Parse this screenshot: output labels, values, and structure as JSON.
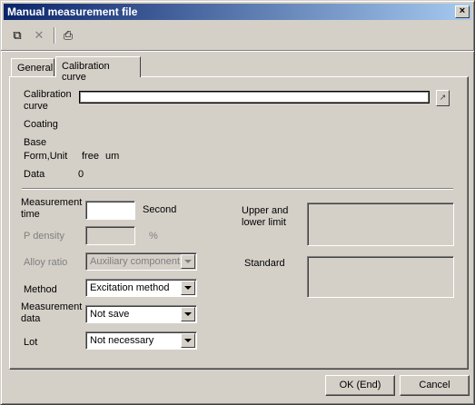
{
  "window": {
    "title": "Manual measurement file",
    "close_glyph": "×"
  },
  "toolbar": {
    "copy_icon": "copy-icon",
    "delete_icon": "delete-x-icon",
    "print_icon": "printer-icon",
    "copy_glyph": "⧉",
    "delete_glyph": "✕",
    "print_glyph": "⎙"
  },
  "tabs": [
    {
      "label": "General"
    },
    {
      "label": "Calibration curve"
    }
  ],
  "calibration": {
    "curve_label_line1": "Calibration",
    "curve_label_line2": "curve",
    "curve_value": "",
    "browse_glyph": "↗",
    "coating_label": "Coating",
    "base_label": "Base",
    "form_unit_label": "Form,Unit",
    "form_value": "free",
    "unit_value": "um",
    "data_label": "Data",
    "data_value": "0"
  },
  "measurement": {
    "time_label_line1": "Measurement",
    "time_label_line2": "time",
    "time_value": "",
    "time_unit": "Second",
    "p_density_label": "P density",
    "p_density_value": "",
    "p_density_unit": "%",
    "alloy_ratio_label": "Alloy ratio",
    "alloy_ratio_value": "Auxiliary component",
    "method_label": "Method",
    "method_value": "Excitation method",
    "data_label_line1": "Measurement",
    "data_label_line2": "data",
    "data_value": "Not save",
    "lot_label": "Lot",
    "lot_value": "Not necessary"
  },
  "limits": {
    "upper_lower_line1": "Upper and",
    "upper_lower_line2": "lower limit",
    "standard_label": "Standard"
  },
  "buttons": {
    "ok": "OK (End)",
    "cancel": "Cancel"
  },
  "colors": {
    "title_start": "#0a246a",
    "title_end": "#a6caf0",
    "face": "#d4d0c8"
  }
}
